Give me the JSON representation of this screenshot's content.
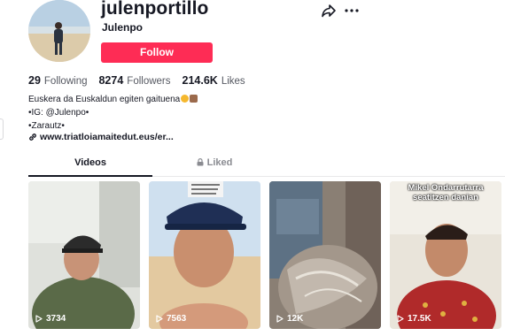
{
  "profile": {
    "username": "julenportillo",
    "nickname": "Julenpo",
    "follow_label": "Follow"
  },
  "header_icons": [
    "share-icon",
    "more-icon"
  ],
  "stats": {
    "following_count": "29",
    "following_label": "Following",
    "followers_count": "8274",
    "followers_label": "Followers",
    "likes_count": "214.6K",
    "likes_label": "Likes"
  },
  "bio": {
    "line1": "Euskera da Euskaldun egiten gaituena",
    "line2": "•IG: @Julenpo•",
    "line3": "•Zarautz•"
  },
  "link": {
    "text": "www.triatloiamaitedut.eus/er..."
  },
  "tabs": {
    "videos": "Videos",
    "liked": "Liked"
  },
  "videos": [
    {
      "views": "3734",
      "caption_overlay": ""
    },
    {
      "views": "7563",
      "caption_overlay": ""
    },
    {
      "views": "12K",
      "caption_overlay": ""
    },
    {
      "views": "17.5K",
      "caption_overlay": "Mikel Ondarrutarra seatitzen danian"
    }
  ],
  "colors": {
    "accent": "#fe2c55",
    "text": "#161823",
    "muted": "#8a8b91"
  }
}
